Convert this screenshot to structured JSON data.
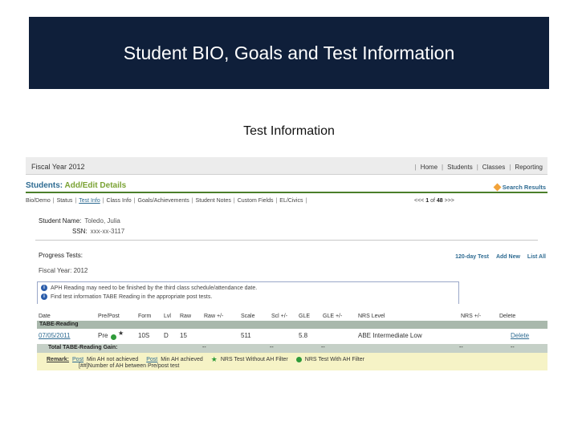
{
  "slide": {
    "title": "Student BIO, Goals and Test Information",
    "subtitle": "Test Information"
  },
  "topbar": {
    "fiscal_year": "Fiscal Year 2012",
    "nav": [
      "Home",
      "Students",
      "Classes",
      "Reporting"
    ]
  },
  "header": {
    "title": "Students:",
    "subtitle": "Add/Edit Details",
    "search_results": "Search Results"
  },
  "tabs": [
    "Bio/Demo",
    "Status",
    "Test Info",
    "Class Info",
    "Goals/Achievements",
    "Student Notes",
    "Custom Fields",
    "EL/Civics"
  ],
  "pager": {
    "prev": "<<<",
    "current": "1",
    "of": "of",
    "total": "48",
    "next": ">>>"
  },
  "student": {
    "name_label": "Student Name:",
    "name_value": "Toledo, Julia",
    "ssn_label": "SSN:",
    "ssn_value": "xxx-xx-3117"
  },
  "progress": {
    "title": "Progress Tests:",
    "links": [
      "120-day Test",
      "Add New",
      "List All"
    ],
    "fiscal_year": "Fiscal Year: 2012"
  },
  "notices": [
    "APH Reading may need to be finished by the third class schedule/attendance date.",
    "Find test information TABE Reading in the appropriate post tests."
  ],
  "table": {
    "headers": [
      "Date",
      "Pre/Post",
      "Form",
      "Lvl",
      "Raw",
      "Raw +/-",
      "Scale",
      "Scl +/-",
      "GLE",
      "GLE +/-",
      "NRS Level",
      "NRS +/-",
      "Delete"
    ],
    "section": "TABE-Reading",
    "row": {
      "date": "07/05/2011",
      "prepost": "Pre",
      "form": "10S",
      "lvl": "D",
      "raw": "15",
      "scale": "511",
      "gle": "5.8",
      "nrs_level": "ABE Intermediate Low",
      "delete": "Delete"
    },
    "gain": {
      "label": "Total TABE-Reading Gain:",
      "values": [
        "--",
        "--",
        "--",
        "--"
      ],
      "end": "--"
    },
    "remark": {
      "label": "Remark:",
      "items": [
        {
          "tag": "Post",
          "text": "Min AH not achieved"
        },
        {
          "tag": "Post",
          "text": "Min AH achieved"
        },
        {
          "text": "NRS Test Without AH Filter"
        },
        {
          "text": "NRS Test With AH Filter"
        }
      ],
      "footnote": "[##]Number of AH between Pre/post test"
    }
  }
}
